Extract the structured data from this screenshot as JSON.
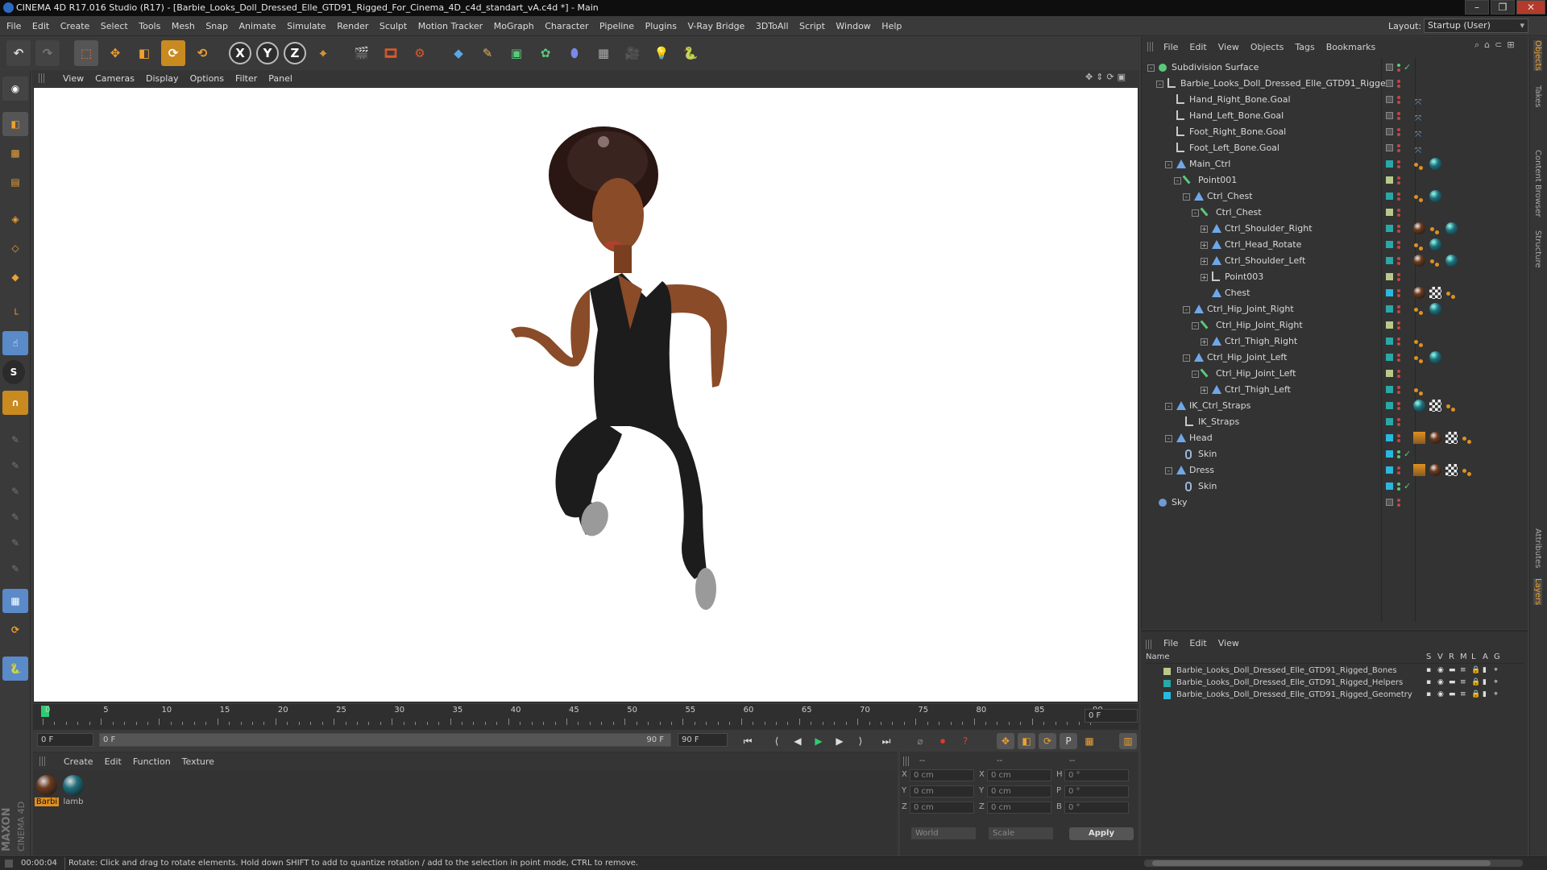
{
  "window": {
    "title": "CINEMA 4D R17.016 Studio (R17) - [Barbie_Looks_Doll_Dressed_Elle_GTD91_Rigged_For_Cinema_4D_c4d_standart_vA.c4d *] - Main",
    "minimize": "–",
    "restore": "❐",
    "close": "✕"
  },
  "menubar": [
    "File",
    "Edit",
    "Create",
    "Select",
    "Tools",
    "Mesh",
    "Snap",
    "Animate",
    "Simulate",
    "Render",
    "Sculpt",
    "Motion Tracker",
    "MoGraph",
    "Character",
    "Pipeline",
    "Plugins",
    "V-Ray Bridge",
    "3DToAll",
    "Script",
    "Window",
    "Help"
  ],
  "layout": {
    "label": "Layout:",
    "value": "Startup (User)"
  },
  "toolbar": {
    "x": "X",
    "y": "Y",
    "z": "Z"
  },
  "viewport_menu": [
    "View",
    "Cameras",
    "Display",
    "Options",
    "Filter",
    "Panel"
  ],
  "object_menu": [
    "File",
    "Edit",
    "View",
    "Objects",
    "Tags",
    "Bookmarks"
  ],
  "objects": [
    {
      "name": "Subdivision Surface",
      "depth": 0,
      "icon": "sub",
      "exp": "-"
    },
    {
      "name": "Barbie_Looks_Doll_Dressed_Elle_GTD91_Rigged",
      "depth": 1,
      "icon": "null",
      "exp": "-"
    },
    {
      "name": "Hand_Right_Bone.Goal",
      "depth": 2,
      "icon": "null",
      "exp": ""
    },
    {
      "name": "Hand_Left_Bone.Goal",
      "depth": 2,
      "icon": "null",
      "exp": ""
    },
    {
      "name": "Foot_Right_Bone.Goal",
      "depth": 2,
      "icon": "null",
      "exp": ""
    },
    {
      "name": "Foot_Left_Bone.Goal",
      "depth": 2,
      "icon": "null",
      "exp": ""
    },
    {
      "name": "Main_Ctrl",
      "depth": 2,
      "icon": "joint",
      "exp": "-"
    },
    {
      "name": "Point001",
      "depth": 3,
      "icon": "bone",
      "exp": "-"
    },
    {
      "name": "Ctrl_Chest",
      "depth": 4,
      "icon": "joint",
      "exp": "-"
    },
    {
      "name": "Ctrl_Chest",
      "depth": 5,
      "icon": "bone",
      "exp": "-"
    },
    {
      "name": "Ctrl_Shoulder_Right",
      "depth": 6,
      "icon": "joint",
      "exp": "+"
    },
    {
      "name": "Ctrl_Head_Rotate",
      "depth": 6,
      "icon": "joint",
      "exp": "+"
    },
    {
      "name": "Ctrl_Shoulder_Left",
      "depth": 6,
      "icon": "joint",
      "exp": "+"
    },
    {
      "name": "Point003",
      "depth": 6,
      "icon": "null",
      "exp": "+"
    },
    {
      "name": "Chest",
      "depth": 6,
      "icon": "joint",
      "exp": ""
    },
    {
      "name": "Ctrl_Hip_Joint_Right",
      "depth": 4,
      "icon": "joint",
      "exp": "-"
    },
    {
      "name": "Ctrl_Hip_Joint_Right",
      "depth": 5,
      "icon": "bone",
      "exp": "-"
    },
    {
      "name": "Ctrl_Thigh_Right",
      "depth": 6,
      "icon": "joint",
      "exp": "+"
    },
    {
      "name": "Ctrl_Hip_Joint_Left",
      "depth": 4,
      "icon": "joint",
      "exp": "-"
    },
    {
      "name": "Ctrl_Hip_Joint_Left",
      "depth": 5,
      "icon": "bone",
      "exp": "-"
    },
    {
      "name": "Ctrl_Thigh_Left",
      "depth": 6,
      "icon": "joint",
      "exp": "+"
    },
    {
      "name": "IK_Ctrl_Straps",
      "depth": 2,
      "icon": "joint",
      "exp": "-"
    },
    {
      "name": "IK_Straps",
      "depth": 3,
      "icon": "null",
      "exp": ""
    },
    {
      "name": "Head",
      "depth": 2,
      "icon": "joint",
      "exp": "-"
    },
    {
      "name": "Skin",
      "depth": 3,
      "icon": "skin",
      "exp": ""
    },
    {
      "name": "Dress",
      "depth": 2,
      "icon": "joint",
      "exp": "-"
    },
    {
      "name": "Skin",
      "depth": 3,
      "icon": "skin",
      "exp": ""
    },
    {
      "name": "Sky",
      "depth": 0,
      "icon": "sky",
      "exp": ""
    }
  ],
  "layers_menu": [
    "File",
    "Edit",
    "View"
  ],
  "layers_header": {
    "name": "Name",
    "cols": [
      "S",
      "V",
      "R",
      "M",
      "L",
      "A",
      "G"
    ]
  },
  "layers": [
    {
      "name": "Barbie_Looks_Doll_Dressed_Elle_GTD91_Rigged_Bones",
      "color": "#b8c98a"
    },
    {
      "name": "Barbie_Looks_Doll_Dressed_Elle_GTD91_Rigged_Helpers",
      "color": "#2aa7a7"
    },
    {
      "name": "Barbie_Looks_Doll_Dressed_Elle_GTD91_Rigged_Geometry",
      "color": "#2ab7e0"
    }
  ],
  "side_tabs": [
    "Objects",
    "Takes",
    "Content Browser",
    "Structure",
    "Attributes",
    "Layers"
  ],
  "timeline": {
    "ticks": [
      "0",
      "5",
      "10",
      "15",
      "20",
      "25",
      "30",
      "35",
      "40",
      "45",
      "50",
      "55",
      "60",
      "65",
      "70",
      "75",
      "80",
      "85",
      "90"
    ],
    "frame_field": "0 F"
  },
  "playback": {
    "start": "0 F",
    "range_start": "0 F",
    "range_end": "90 F",
    "end": "90 F"
  },
  "material_menu": [
    "Create",
    "Edit",
    "Function",
    "Texture"
  ],
  "materials": [
    {
      "label": "Barbi",
      "color": "#6b3a1e"
    },
    {
      "label": "lamb",
      "color": "#1f6f7d"
    }
  ],
  "coords": {
    "header": [
      "--",
      "--",
      "--"
    ],
    "rows": [
      {
        "a": "X",
        "av": "0 cm",
        "b": "X",
        "bv": "0 cm",
        "c": "H",
        "cv": "0 °"
      },
      {
        "a": "Y",
        "av": "0 cm",
        "b": "Y",
        "bv": "0 cm",
        "c": "P",
        "cv": "0 °"
      },
      {
        "a": "Z",
        "av": "0 cm",
        "b": "Z",
        "bv": "0 cm",
        "c": "B",
        "cv": "0 °"
      }
    ],
    "world": "World",
    "scale": "Scale",
    "apply": "Apply"
  },
  "status": {
    "time": "00:00:04",
    "message": "Rotate: Click and drag to rotate elements. Hold down SHIFT to add to quantize rotation / add to the selection in point mode, CTRL to remove."
  },
  "maxon": "MAXON",
  "cinema": "CINEMA 4D"
}
